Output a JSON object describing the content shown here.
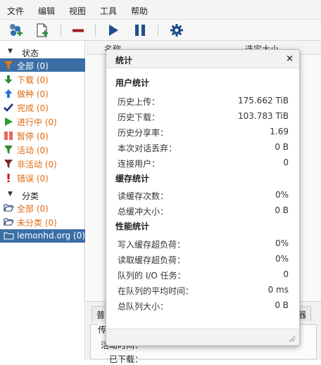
{
  "menu": [
    "文件",
    "编辑",
    "视图",
    "工具",
    "帮助"
  ],
  "toolbar": {
    "add_torrent_icon": "add-torrent-icon",
    "new_file_icon": "new-file-icon",
    "remove_icon": "remove-icon",
    "start_icon": "play-icon",
    "pause_icon": "pause-icon",
    "settings_icon": "gear-icon"
  },
  "sidebar": {
    "status_header": "状态",
    "status_items": [
      {
        "label": "全部 (0)",
        "icon": "filter-icon",
        "active": true
      },
      {
        "label": "下载 (0)",
        "icon": "arrow-down-icon"
      },
      {
        "label": "做种 (0)",
        "icon": "arrow-up-icon"
      },
      {
        "label": "完成 (0)",
        "icon": "check-icon"
      },
      {
        "label": "进行中 (0)",
        "icon": "play-icon"
      },
      {
        "label": "暂停 (0)",
        "icon": "pause-icon"
      },
      {
        "label": "活动 (0)",
        "icon": "filter-icon"
      },
      {
        "label": "非活动 (0)",
        "icon": "filter-icon"
      },
      {
        "label": "错误 (0)",
        "icon": "exclamation-icon"
      }
    ],
    "category_header": "分类",
    "category_items": [
      {
        "label": "全部 (0)",
        "icon": "folder-open-icon"
      },
      {
        "label": "未分类 (0)",
        "icon": "folder-open-icon"
      }
    ],
    "tracker_item": {
      "label": "lemonhd.org (0)",
      "icon": "folder-icon"
    }
  },
  "columns": {
    "name": "名称",
    "size": "选定大小"
  },
  "bottom_panel": {
    "tab_left": "普",
    "tab_right": "器",
    "section_label": "传",
    "active_time_label": "活动时间：",
    "partial_text": "已下载："
  },
  "dialog": {
    "title": "统计",
    "close": "×",
    "user_stats": {
      "title": "用户统计",
      "rows": [
        {
          "label": "历史上传：",
          "value": "175.662 TiB"
        },
        {
          "label": "历史下载：",
          "value": "103.783 TiB"
        },
        {
          "label": "历史分享率：",
          "value": "1.69"
        },
        {
          "label": "本次对话丢弃：",
          "value": "0 B"
        },
        {
          "label": "连接用户：",
          "value": "0"
        }
      ]
    },
    "cache_stats": {
      "title": "缓存统计",
      "rows": [
        {
          "label": "读缓存次数：",
          "value": "0%"
        },
        {
          "label": "总缓冲大小：",
          "value": "0 B"
        }
      ]
    },
    "perf_stats": {
      "title": "性能统计",
      "rows": [
        {
          "label": "写入缓存超负荷：",
          "value": "0%"
        },
        {
          "label": "读取缓存超负荷：",
          "value": "0%"
        },
        {
          "label": "队列的 I/O 任务：",
          "value": "0"
        },
        {
          "label": "在队列的平均时间：",
          "value": "0 ms"
        },
        {
          "label": "总队列大小：",
          "value": "0 B"
        }
      ]
    }
  },
  "colors": {
    "accent_selected": "#3a6ea5",
    "status_text": "#e06a10",
    "download_green": "#2e8b2e",
    "seed_blue": "#2a6fd6",
    "error_red": "#d01010"
  }
}
